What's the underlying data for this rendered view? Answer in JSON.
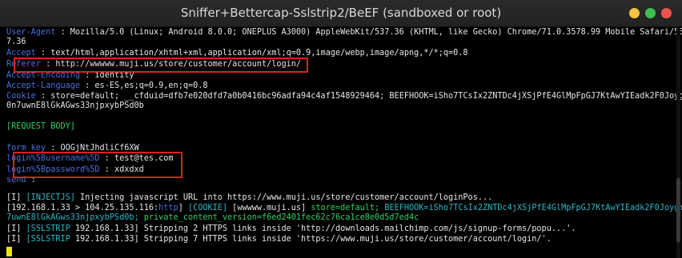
{
  "window": {
    "title": "Sniffer+Bettercap-Sslstrip2/BeEF (sandboxed or root)",
    "buttons": {
      "minimize_color": "#f6c343",
      "maximize_color": "#3fbf4f",
      "close_color": "#ef5350"
    }
  },
  "colors": {
    "header_key": "#4a6fe0",
    "text": "#e6e6e6",
    "cyan": "#2ab9c6",
    "green": "#2fd266",
    "highlight_box": "#e01f1f",
    "cursor": "#e9e900"
  },
  "headers": {
    "user_agent": {
      "key": "User-Agent",
      "sep": " : ",
      "value": "Mozilla/5.0 (Linux; Android 8.0.0; ONEPLUS A3000) AppleWebKit/537.36 (KHTML, like Gecko) Chrome/71.0.3578.99 Mobile Safari/53",
      "wrap": "7.36"
    },
    "accept": {
      "key": "Accept",
      "sep": " : ",
      "value": "text/html,application/xhtml+xml,application/xml;q=0.9,image/webp,image/apng,*/*;q=0.8"
    },
    "referer": {
      "key": "Referer",
      "sep": " : ",
      "value": "http://wwwww.muji.us/store/customer/account/login/"
    },
    "accept_encoding": {
      "key": "Accept-Encoding",
      "sep": " : ",
      "value": "identity"
    },
    "accept_language": {
      "key": "Accept-Language",
      "sep": " : ",
      "value": "es-ES,es;q=0.9,en;q=0.8"
    },
    "cookie": {
      "key": "Cookie",
      "sep": " : ",
      "value": "store=default; __cfduid=dfb7e020dfd7a0b0416bc96adfa94c4af1548929464; BEEFHOOK=iSho7TCsIx2ZNTDc4jXSjPfE4GlMpFpGJ7KtAwYIEadk2F0Joygm",
      "wrap": "0n7uwnE8lGkAGws33njpxybPSd0b"
    }
  },
  "request_body": {
    "label": "[REQUEST BODY]",
    "form_key": {
      "key": "form_key",
      "sep": " : ",
      "value": "OOGjNtJhdliCf6XW"
    },
    "username": {
      "key": "login%5Busername%5D",
      "sep": " : ",
      "value": "test@tes.com"
    },
    "password": {
      "key": "login%5Bpassword%5D",
      "sep": " : ",
      "value": "xdxdxd"
    },
    "send": {
      "key": "send",
      "sep": " : ",
      "value": ""
    }
  },
  "log": {
    "line1": {
      "prefix": "[I] ",
      "tag": "[INJECTJS]",
      "text": " Injecting javascript URL into https://www.muji.us/store/customer/account/loginPos..."
    },
    "line2": {
      "part1": "[192.168.1.33 > 104.25.135.116:",
      "proto": "http",
      "part2": "] ",
      "tag": "[COOKIE]",
      "host": " [wwwww.muji.us] ",
      "store": "store=default; ",
      "beef": "BEEFHOOK=iSho7TCsIx2ZNTDc4jXSjPfE4GlMpFpGJ7KtAwYIEadk2F0Joygm0n"
    },
    "line3": {
      "part1": "7uwnE8lGkAGws33njpxybPSd0b; ",
      "cookie": "private_content_version=f6ed2401fec62c76ca1ce8e0d5d7ed4c"
    },
    "line4": {
      "prefix": "[I] ",
      "tag": "[SSLSTRIP",
      "text": " 192.168.1.33] Stripping 2 HTTPS links inside 'http://downloads.mailchimp.com/js/signup-forms/popu...'."
    },
    "line5": {
      "prefix": "[I] ",
      "tag": "[SSLSTRIP",
      "text": " 192.168.1.33] Stripping 7 HTTPS links inside 'https://www.muji.us/store/customer/account/login/'."
    }
  }
}
